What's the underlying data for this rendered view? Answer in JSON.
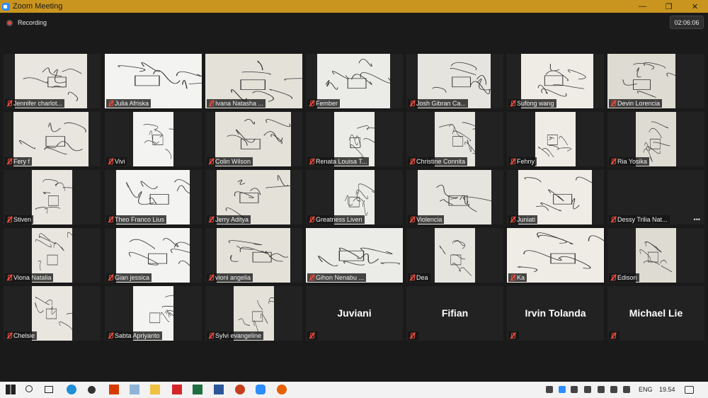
{
  "window": {
    "title": "Zoom Meeting",
    "minimize": "—",
    "restore": "❐",
    "close": "✕"
  },
  "recording": {
    "label": "Recording"
  },
  "timer": "02:06:06",
  "participants": [
    {
      "name": "Jennifer charlot...",
      "video": true
    },
    {
      "name": "Julia Afriska",
      "video": true
    },
    {
      "name": "Ivana Natasha ...",
      "video": true
    },
    {
      "name": "Fember",
      "video": true
    },
    {
      "name": "Josh Gibran Ca...",
      "video": true
    },
    {
      "name": "Sufong wang",
      "video": true
    },
    {
      "name": "Devin Lorencia",
      "video": true
    },
    {
      "name": "Fery f",
      "video": true
    },
    {
      "name": "Vivi",
      "video": true
    },
    {
      "name": "Colin Wilson",
      "video": true
    },
    {
      "name": "Renata Louisa T...",
      "video": true
    },
    {
      "name": "Christine Connita",
      "video": true
    },
    {
      "name": "Fehny",
      "video": true
    },
    {
      "name": "Ria Yosika",
      "video": true
    },
    {
      "name": "Stiven",
      "video": true
    },
    {
      "name": "Theo Franco Lius",
      "video": true
    },
    {
      "name": "Jerry Aditya",
      "video": true
    },
    {
      "name": "Greatness Liven",
      "video": true
    },
    {
      "name": "Violencia",
      "video": true
    },
    {
      "name": "Juniati",
      "video": true
    },
    {
      "name": "Dessy Trilia Nat...",
      "video": false,
      "more": "•••"
    },
    {
      "name": "Viona Natalia",
      "video": true
    },
    {
      "name": "Gian jessica",
      "video": true
    },
    {
      "name": "vioni angelia",
      "video": true
    },
    {
      "name": "Gihon Nenabu ...",
      "video": true
    },
    {
      "name": "Dea",
      "video": true
    },
    {
      "name": "Ka",
      "video": true
    },
    {
      "name": "Edison",
      "video": true
    },
    {
      "name": "Chelsie",
      "video": true
    },
    {
      "name": "Sabta Apriyanto",
      "video": true
    },
    {
      "name": "Sylvi evangeline",
      "video": true
    },
    {
      "name": "Juviani",
      "video": false,
      "big": true
    },
    {
      "name": "Fifian",
      "video": false,
      "big": true
    },
    {
      "name": "Irvin Tolanda",
      "video": false,
      "big": true
    },
    {
      "name": "Michael Lie",
      "video": false,
      "big": true
    }
  ],
  "taskbar": {
    "language": "ENG",
    "clock": "19.54",
    "icons": [
      "windows-start-icon",
      "search-icon",
      "task-view-icon",
      "edge-icon",
      "settings-icon",
      "office-icon",
      "notepad-icon",
      "file-explorer-icon",
      "acrobat-icon",
      "excel-icon",
      "word-icon",
      "powerpoint-icon",
      "zoom-icon",
      "firefox-icon"
    ],
    "colors": {
      "edge": "#1f8fd6",
      "office": "#d83b01",
      "excel": "#1d6f42",
      "word": "#2b579a",
      "powerpoint": "#c43e1c",
      "acrobat": "#d4262a",
      "zoom": "#2d8cff",
      "firefox": "#e66000",
      "folder": "#f0c040"
    }
  }
}
